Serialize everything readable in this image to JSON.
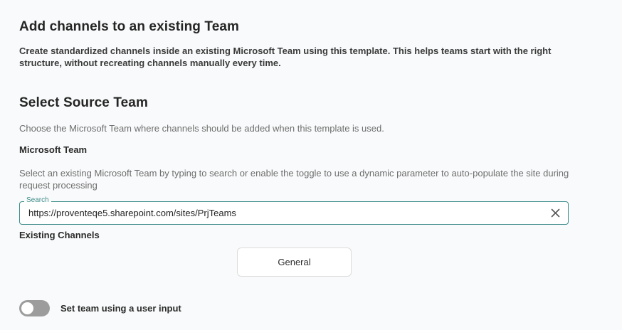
{
  "header": {
    "title": "Add channels to an existing Team",
    "description": "Create standardized channels inside an existing Microsoft Team using this template. This helps teams start with the right structure, without recreating channels manually every time."
  },
  "source_team": {
    "title": "Select Source Team",
    "description": "Choose the Microsoft Team where channels should be added when this template is used.",
    "field_label": "Microsoft Team",
    "field_help": "Select an existing Microsoft Team by typing to search or enable the toggle to use a dynamic parameter to auto-populate the site during request processing",
    "search": {
      "legend": "Search",
      "value": "https://proventeqe5.sharepoint.com/sites/PrjTeams",
      "clear_icon": "close-icon"
    }
  },
  "existing_channels": {
    "label": "Existing Channels",
    "items": [
      "General"
    ]
  },
  "toggle": {
    "label": "Set team using a user input",
    "enabled": false
  },
  "colors": {
    "accent": "#3e8e8a",
    "toggle_off": "#9c9c9c",
    "background": "#f9fafb"
  }
}
